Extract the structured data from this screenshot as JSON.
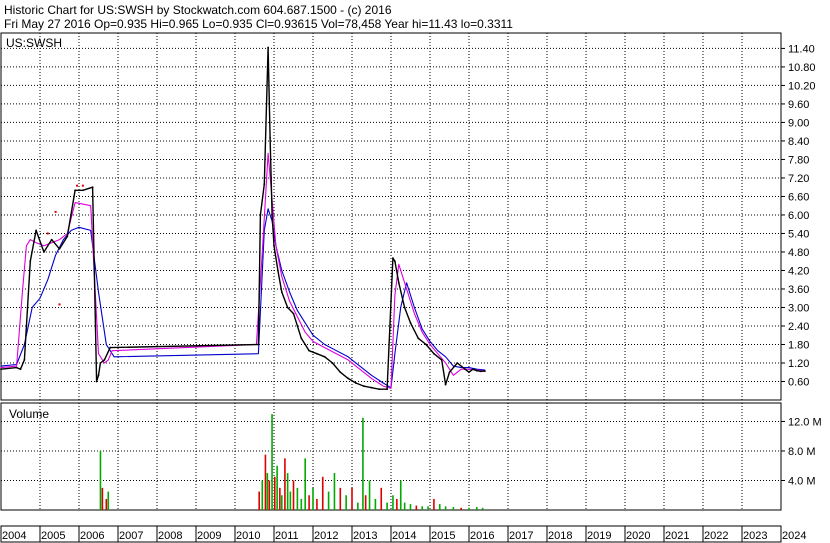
{
  "header": {
    "line1": "Historic Chart for US:SWSH by Stockwatch.com 604.687.1500 - (c) 2016",
    "line2": "Fri May 27 2016   Op=0.935   Hi=0.965   Lo=0.935   Cl=0.93615   Vol=78,458   Year hi=11.43   lo=0.3311"
  },
  "colors": {
    "background": "#ffffff",
    "grid": "#000000",
    "price": "#000000",
    "up_volume": "#00aa00",
    "down_volume": "#dd0000",
    "ma_short": "#dd00dd",
    "ma_long": "#0000cc"
  },
  "chart_data": [
    {
      "type": "line",
      "title": "US:SWSH",
      "y_ticks": [
        "11.40",
        "10.80",
        "10.20",
        "9.60",
        "9.00",
        "8.40",
        "7.80",
        "7.20",
        "6.60",
        "6.00",
        "5.40",
        "4.80",
        "4.20",
        "3.60",
        "3.00",
        "2.40",
        "1.80",
        "1.20",
        "0.60"
      ],
      "ylim": [
        0,
        11.9
      ],
      "x_ticks": [
        "2004",
        "2005",
        "2006",
        "2007",
        "2008",
        "2009",
        "2010",
        "2011",
        "2012",
        "2013",
        "2014",
        "2015",
        "2016",
        "2017",
        "2018",
        "2019",
        "2020",
        "2021",
        "2022",
        "2023",
        "2024"
      ],
      "xlim": [
        2004.0,
        2024.0
      ],
      "grid": true,
      "series": [
        {
          "role": "price",
          "x": [
            2004.0,
            2004.4,
            2004.5,
            2004.6,
            2004.75,
            2004.9,
            2005.1,
            2005.3,
            2005.5,
            2005.7,
            2005.9,
            2006.1,
            2006.35,
            2006.45,
            2006.5,
            2006.55,
            2006.65,
            2006.8,
            2010.6,
            2010.65,
            2010.75,
            2010.85,
            2010.9,
            2010.95,
            2011.0,
            2011.1,
            2011.2,
            2011.35,
            2011.5,
            2011.7,
            2011.9,
            2012.1,
            2012.3,
            2012.5,
            2012.7,
            2012.9,
            2013.1,
            2013.3,
            2013.5,
            2013.7,
            2013.9,
            2014.0,
            2014.05,
            2014.1,
            2014.2,
            2014.35,
            2014.5,
            2014.7,
            2014.9,
            2015.1,
            2015.3,
            2015.4,
            2015.5,
            2015.7,
            2015.9,
            2016.0,
            2016.1,
            2016.2,
            2016.3,
            2016.41
          ],
          "y": [
            1.0,
            1.05,
            1.0,
            1.3,
            4.5,
            5.5,
            4.8,
            5.2,
            4.9,
            5.3,
            6.8,
            6.8,
            6.9,
            0.6,
            0.8,
            1.2,
            1.3,
            1.7,
            1.8,
            6.0,
            7.0,
            11.43,
            8.5,
            6.0,
            5.0,
            4.2,
            3.5,
            3.0,
            2.8,
            2.0,
            1.6,
            1.5,
            1.4,
            1.2,
            0.9,
            0.7,
            0.55,
            0.45,
            0.4,
            0.35,
            0.35,
            3.2,
            4.6,
            4.5,
            3.8,
            3.0,
            2.5,
            2.0,
            1.8,
            1.5,
            1.3,
            0.5,
            0.9,
            1.2,
            1.0,
            0.9,
            1.0,
            0.95,
            0.93,
            0.94
          ]
        },
        {
          "role": "ma_short",
          "x": [
            2004.0,
            2004.4,
            2004.55,
            2004.65,
            2004.75,
            2004.9,
            2005.1,
            2005.3,
            2005.5,
            2005.7,
            2005.9,
            2006.3,
            2006.5,
            2006.65,
            2006.75,
            2006.85,
            2010.55,
            2010.7,
            2010.85,
            2010.95,
            2011.05,
            2011.2,
            2011.4,
            2011.6,
            2011.8,
            2012.0,
            2012.3,
            2012.6,
            2012.9,
            2013.2,
            2013.5,
            2013.8,
            2014.0,
            2014.1,
            2014.2,
            2014.4,
            2014.6,
            2014.8,
            2015.0,
            2015.2,
            2015.4,
            2015.6,
            2015.8,
            2016.0,
            2016.2,
            2016.41
          ],
          "y": [
            1.05,
            1.1,
            3.5,
            5.0,
            5.2,
            5.1,
            5.0,
            5.1,
            5.2,
            5.4,
            6.4,
            6.3,
            1.5,
            1.2,
            1.3,
            1.6,
            1.8,
            4.8,
            8.0,
            6.5,
            5.0,
            4.0,
            3.2,
            2.7,
            2.2,
            1.9,
            1.7,
            1.5,
            1.3,
            1.0,
            0.7,
            0.45,
            0.38,
            3.4,
            4.4,
            3.6,
            2.8,
            2.2,
            1.8,
            1.5,
            1.2,
            0.8,
            1.0,
            1.0,
            0.97,
            0.94
          ]
        },
        {
          "role": "ma_long",
          "x": [
            2004.0,
            2004.4,
            2004.6,
            2004.8,
            2005.0,
            2005.2,
            2005.4,
            2005.6,
            2005.8,
            2006.0,
            2006.3,
            2006.5,
            2006.7,
            2006.9,
            2010.6,
            2010.75,
            2010.85,
            2010.95,
            2011.05,
            2011.2,
            2011.4,
            2011.6,
            2011.8,
            2012.0,
            2012.3,
            2012.6,
            2012.9,
            2013.2,
            2013.5,
            2013.8,
            2014.0,
            2014.1,
            2014.25,
            2014.4,
            2014.6,
            2014.8,
            2015.0,
            2015.2,
            2015.4,
            2015.6,
            2015.8,
            2016.0,
            2016.2,
            2016.41
          ],
          "y": [
            1.1,
            1.15,
            1.8,
            3.0,
            3.3,
            3.9,
            4.7,
            5.2,
            5.5,
            5.6,
            5.5,
            3.5,
            1.8,
            1.4,
            1.5,
            5.5,
            6.2,
            5.8,
            5.0,
            4.2,
            3.5,
            2.9,
            2.5,
            2.1,
            1.8,
            1.6,
            1.4,
            1.1,
            0.8,
            0.55,
            0.4,
            1.5,
            3.0,
            3.8,
            3.0,
            2.3,
            1.9,
            1.6,
            1.4,
            1.1,
            1.05,
            1.05,
            1.0,
            0.97
          ]
        }
      ],
      "annotations": [
        {
          "x": 2005.95,
          "y": 6.95
        },
        {
          "x": 2006.1,
          "y": 6.95
        },
        {
          "x": 2005.4,
          "y": 6.1
        },
        {
          "x": 2005.5,
          "y": 3.1
        },
        {
          "x": 2005.2,
          "y": 5.4
        }
      ]
    },
    {
      "type": "bar",
      "title": "Volume",
      "y_ticks": [
        "12.0 M",
        "8.0 M",
        "4.0 M"
      ],
      "ylim": [
        0,
        14.5
      ],
      "unit": "M",
      "x": [
        2006.55,
        2006.6,
        2006.7,
        2006.75,
        2010.62,
        2010.7,
        2010.78,
        2010.83,
        2010.88,
        2010.95,
        2011.02,
        2011.08,
        2011.15,
        2011.2,
        2011.28,
        2011.35,
        2011.42,
        2011.5,
        2011.6,
        2011.7,
        2011.8,
        2011.9,
        2012.0,
        2012.1,
        2012.25,
        2012.4,
        2012.55,
        2012.7,
        2012.85,
        2013.0,
        2013.15,
        2013.28,
        2013.35,
        2013.45,
        2013.6,
        2013.75,
        2013.9,
        2014.05,
        2014.15,
        2014.25,
        2014.35,
        2014.5,
        2014.65,
        2014.8,
        2014.95,
        2015.1,
        2015.25,
        2015.4,
        2015.6,
        2015.8,
        2016.0,
        2016.2,
        2016.35
      ],
      "values": [
        8.0,
        3.0,
        1.5,
        2.5,
        2.5,
        4.0,
        7.5,
        5.0,
        4.0,
        13.0,
        4.5,
        6.0,
        3.0,
        2.0,
        7.0,
        5.0,
        2.5,
        4.0,
        3.0,
        1.5,
        7.0,
        2.0,
        3.0,
        1.5,
        4.5,
        2.5,
        5.0,
        3.0,
        2.0,
        3.0,
        1.0,
        12.5,
        2.0,
        4.0,
        1.5,
        3.0,
        1.0,
        2.0,
        1.5,
        4.0,
        1.0,
        0.8,
        0.6,
        0.5,
        0.5,
        1.5,
        0.8,
        0.5,
        0.4,
        0.3,
        0.3,
        0.4,
        0.3
      ],
      "down": [
        false,
        true,
        true,
        false,
        true,
        false,
        true,
        false,
        true,
        false,
        true,
        false,
        true,
        false,
        true,
        false,
        false,
        true,
        false,
        false,
        false,
        true,
        false,
        true,
        true,
        false,
        false,
        true,
        false,
        true,
        false,
        false,
        true,
        false,
        false,
        true,
        false,
        false,
        true,
        false,
        false,
        false,
        true,
        false,
        false,
        true,
        false,
        false,
        false,
        true,
        false,
        false,
        false
      ]
    }
  ]
}
